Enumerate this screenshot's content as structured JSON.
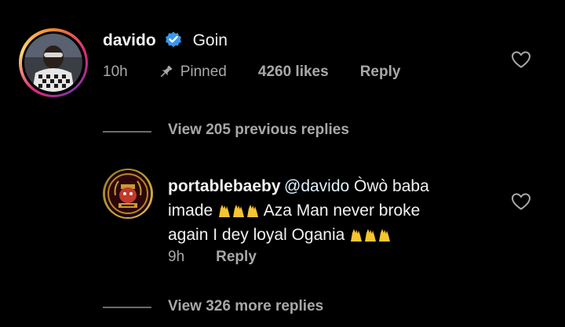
{
  "main_comment": {
    "username": "davido",
    "verified": true,
    "text": "Goin",
    "time": "10h",
    "pinned_label": "Pinned",
    "likes": "4260 likes",
    "reply_label": "Reply"
  },
  "view_previous": "View 205 previous replies",
  "reply_comment": {
    "username": "portablebaeby",
    "mention": "@davido",
    "text_line1": " Òwò baba",
    "text_line2_a": "imade ",
    "text_line2_b": " Aza Man never broke",
    "text_line3": "again I dey loyal Ogania ",
    "time": "9h",
    "reply_label": "Reply"
  },
  "view_more": "View 326 more replies",
  "colors": {
    "background": "#000000",
    "text": "#f2f2f2",
    "muted": "#a8a8a8",
    "mention": "#e0f1ff",
    "verified_blue": "#3897f0",
    "emoji_yellow": "#f7c531"
  },
  "icons": [
    "verified-badge-icon",
    "pin-icon",
    "heart-icon",
    "raising-hands-emoji"
  ]
}
